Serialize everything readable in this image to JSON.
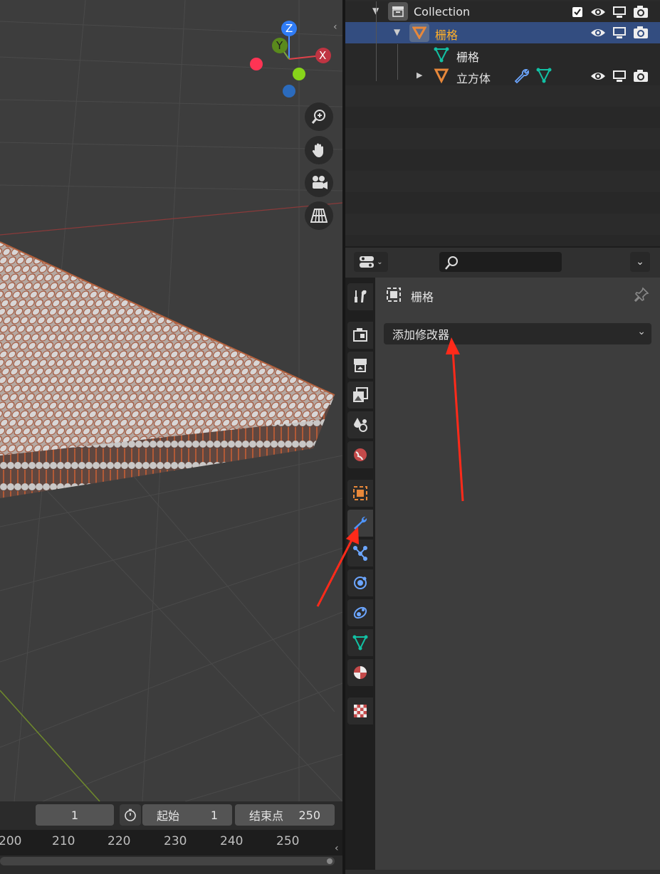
{
  "outliner": {
    "rows": [
      {
        "label": "Collection"
      },
      {
        "label": "栅格"
      },
      {
        "label": "栅格"
      },
      {
        "label": "立方体"
      }
    ]
  },
  "properties": {
    "object_name": "栅格",
    "add_modifier_label": "添加修改器"
  },
  "timeline": {
    "current_frame": "1",
    "start_label": "起始",
    "start_value": "1",
    "end_label": "结束点",
    "end_value": "250",
    "ruler": [
      "200",
      "210",
      "220",
      "230",
      "240",
      "250"
    ]
  },
  "gizmo": {
    "x": "X",
    "y": "Y",
    "z": "Z"
  },
  "colors": {
    "selection": "#334d80",
    "orange": "#e8883a",
    "mesh_green": "#12c1a4",
    "annotation_red": "#ff2a1a"
  }
}
